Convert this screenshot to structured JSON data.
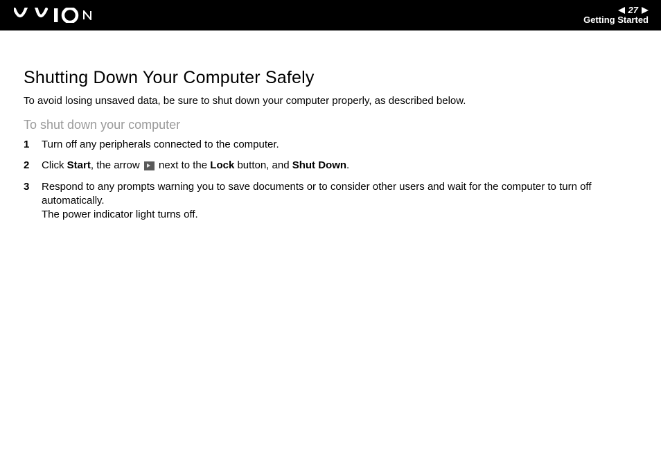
{
  "header": {
    "logo_alt": "VAIO",
    "page_number": "27",
    "section": "Getting Started"
  },
  "content": {
    "title": "Shutting Down Your Computer Safely",
    "intro": "To avoid losing unsaved data, be sure to shut down your computer properly, as described below.",
    "subheading": "To shut down your computer",
    "steps": [
      {
        "num": "1",
        "text_plain": "Turn off any peripherals connected to the computer."
      },
      {
        "num": "2",
        "parts": {
          "a": "Click ",
          "b": "Start",
          "c": ", the arrow ",
          "d": " next to the ",
          "e": "Lock",
          "f": " button, and ",
          "g": "Shut Down",
          "h": "."
        }
      },
      {
        "num": "3",
        "parts": {
          "a": "Respond to any prompts warning you to save documents or to consider other users and wait for the computer to turn off automatically.",
          "b": "The power indicator light turns off."
        }
      }
    ]
  }
}
